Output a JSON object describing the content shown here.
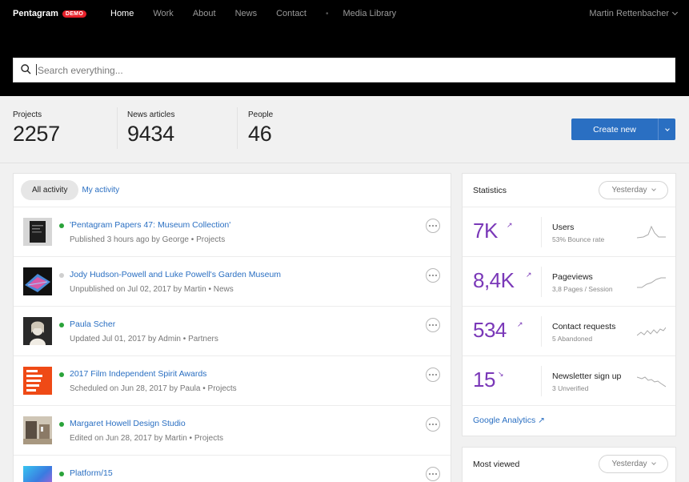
{
  "header": {
    "brand": "Pentagram",
    "badge": "DEMO",
    "nav": [
      "Home",
      "Work",
      "About",
      "News",
      "Contact"
    ],
    "nav_extra": "Media Library",
    "separator": "•",
    "user": "Martin Rettenbacher",
    "search_placeholder": "Search everything..."
  },
  "stats": {
    "projects": {
      "label": "Projects",
      "value": "2257"
    },
    "news": {
      "label": "News articles",
      "value": "9434"
    },
    "people": {
      "label": "People",
      "value": "46"
    },
    "create_label": "Create new"
  },
  "activity": {
    "tabs": [
      "All activity",
      "My activity"
    ],
    "separator": "•",
    "items": [
      {
        "title": "'Pentagram Papers 47: Museum Collection'",
        "meta": "Published 3 hours ago by George",
        "section": "Projects",
        "status": "published"
      },
      {
        "title": "Jody Hudson-Powell and Luke Powell's Garden Museum",
        "meta": "Unpublished on Jul 02, 2017 by Martin",
        "section": "News",
        "status": "unpublished"
      },
      {
        "title": "Paula Scher",
        "meta": "Updated Jul 01, 2017 by Admin",
        "section": "Partners",
        "status": "published"
      },
      {
        "title": "2017 Film Independent Spirit Awards",
        "meta": "Scheduled on Jun 28, 2017 by Paula",
        "section": "Projects",
        "status": "published"
      },
      {
        "title": "Margaret Howell Design Studio",
        "meta": "Edited on Jun 28, 2017 by Martin",
        "section": "Projects",
        "status": "published"
      },
      {
        "title": "Platform/15",
        "meta": "",
        "section": "",
        "status": "published"
      }
    ]
  },
  "statistics": {
    "title": "Statistics",
    "period": "Yesterday",
    "metrics": [
      {
        "value": "7K",
        "trend": "up",
        "arrow": "↗",
        "label": "Users",
        "sub": "53% Bounce rate"
      },
      {
        "value": "8,4K",
        "trend": "up",
        "arrow": "↗",
        "label": "Pageviews",
        "sub": "3,8 Pages / Session"
      },
      {
        "value": "534",
        "trend": "up",
        "arrow": "↗",
        "label": "Contact requests",
        "sub": "5 Abandoned"
      },
      {
        "value": "15",
        "trend": "down",
        "arrow": "↘",
        "label": "Newsletter sign up",
        "sub": "3 Unverified"
      }
    ],
    "ga_link": "Google Analytics ↗"
  },
  "most_viewed": {
    "title": "Most viewed",
    "period": "Yesterday"
  },
  "colors": {
    "accent": "#2a6fc2",
    "metric": "#7a38b8",
    "published": "#2aa33a",
    "unpublished": "#cfcfcf",
    "badge": "#e8202a"
  }
}
